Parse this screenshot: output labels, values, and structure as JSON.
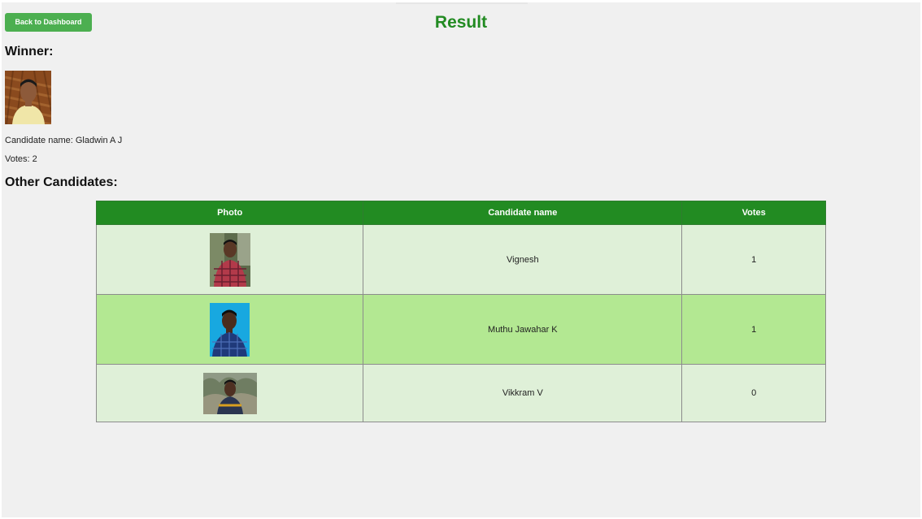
{
  "header": {
    "back_button_label": "Back to Dashboard",
    "title": "Result"
  },
  "winner": {
    "heading": "Winner:",
    "name_line": "Candidate name: Gladwin A J",
    "votes_line": "Votes: 2"
  },
  "others": {
    "heading": "Other Candidates:",
    "columns": [
      "Photo",
      "Candidate name",
      "Votes"
    ],
    "rows": [
      {
        "name": "Vignesh",
        "votes": "1"
      },
      {
        "name": "Muthu Jawahar K",
        "votes": "1"
      },
      {
        "name": "Vikkram V",
        "votes": "0"
      }
    ]
  },
  "colors": {
    "accent_green": "#228b22",
    "button_green": "#4caf50",
    "row_light": "#dff0d8",
    "row_dark": "#b3e892",
    "page_background": "#f0f0f0"
  }
}
